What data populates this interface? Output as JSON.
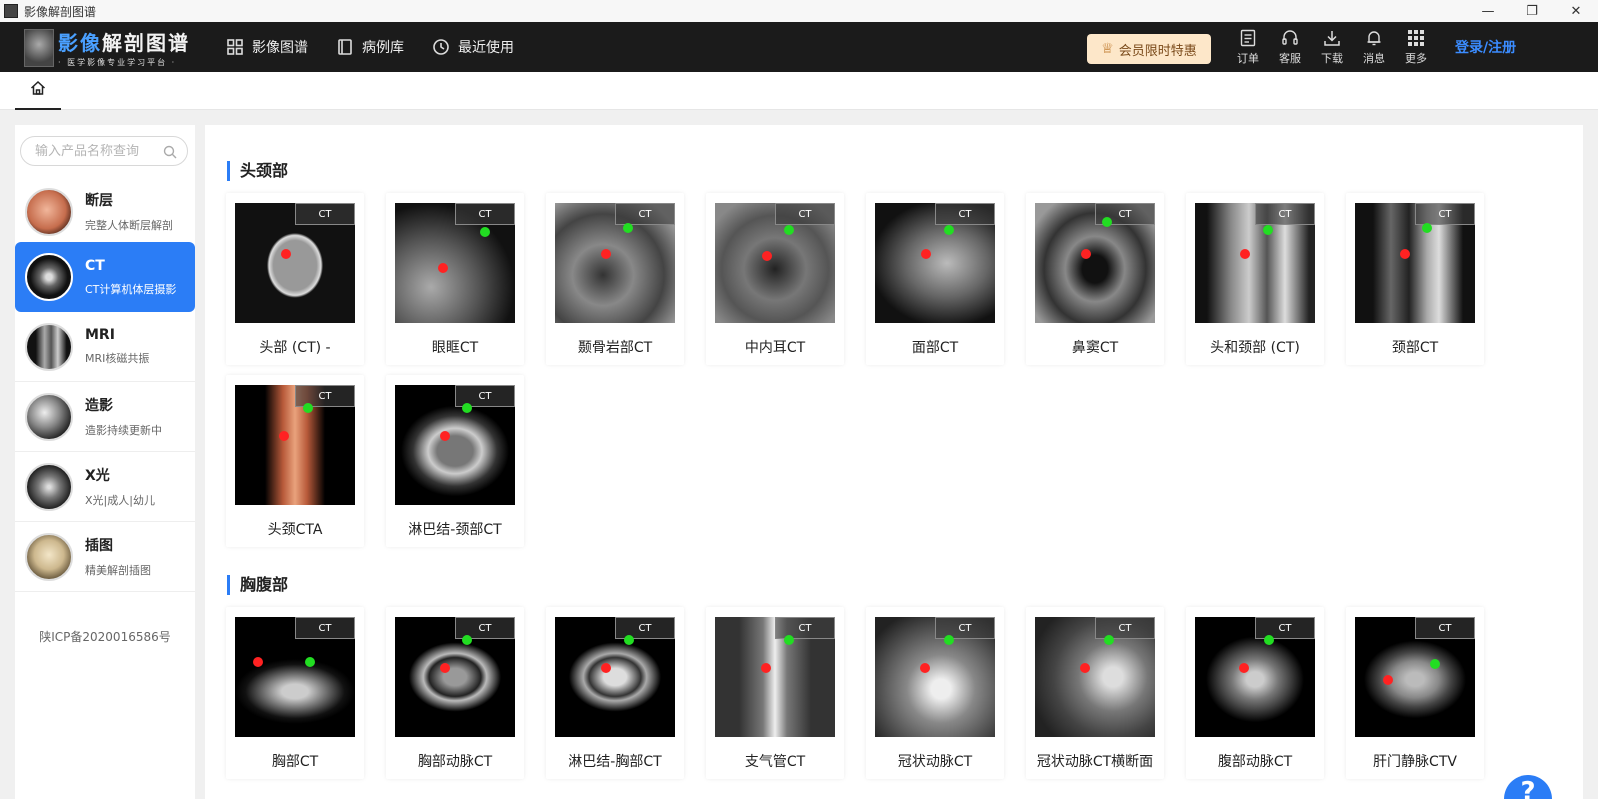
{
  "window": {
    "title": "影像解剖图谱",
    "minimize": "—",
    "maximize": "❐",
    "close": "✕"
  },
  "logo": {
    "main_a": "影像",
    "main_b": "解剖图谱",
    "sub": "· 医学影像专业学习平台 ·"
  },
  "nav": [
    {
      "label": "影像图谱",
      "icon": "grid-icon"
    },
    {
      "label": "病例库",
      "icon": "book-icon"
    },
    {
      "label": "最近使用",
      "icon": "history-icon"
    }
  ],
  "vip": {
    "label": "会员限时特惠",
    "icon": "crown-icon"
  },
  "tools": [
    {
      "label": "订单",
      "icon": "order-icon"
    },
    {
      "label": "客服",
      "icon": "headset-icon"
    },
    {
      "label": "下载",
      "icon": "download-icon"
    },
    {
      "label": "消息",
      "icon": "bell-icon"
    },
    {
      "label": "更多",
      "icon": "more-icon"
    }
  ],
  "login_label": "登录/注册",
  "search": {
    "placeholder": "输入产品名称查询"
  },
  "categories": [
    {
      "name": "断层",
      "desc": "完整人体断层解剖",
      "active": false
    },
    {
      "name": "CT",
      "desc": "CT计算机体层摄影",
      "active": true
    },
    {
      "name": "MRI",
      "desc": "MRI核磁共振",
      "active": false
    },
    {
      "name": "造影",
      "desc": "造影持续更新中",
      "active": false
    },
    {
      "name": "X光",
      "desc": "X光|成人|幼儿",
      "active": false
    },
    {
      "name": "插图",
      "desc": "精美解剖插图",
      "active": false
    }
  ],
  "icp": "陕ICP备2020016586号",
  "ct_tag": "CT",
  "sections": [
    {
      "title": "头颈部",
      "items": [
        "头部 (CT) -",
        "眼眶CT",
        "颞骨岩部CT",
        "中内耳CT",
        "面部CT",
        "鼻窦CT",
        "头和颈部 (CT)",
        "颈部CT",
        "头颈CTA",
        "淋巴结-颈部CT"
      ]
    },
    {
      "title": "胸腹部",
      "items": [
        "胸部CT",
        "胸部动脉CT",
        "淋巴结-胸部CT",
        "支气管CT",
        "冠状动脉CT",
        "冠状动脉CT横断面",
        "腹部动脉CT",
        "肝门静脉CTV"
      ]
    }
  ],
  "help_label": "?"
}
